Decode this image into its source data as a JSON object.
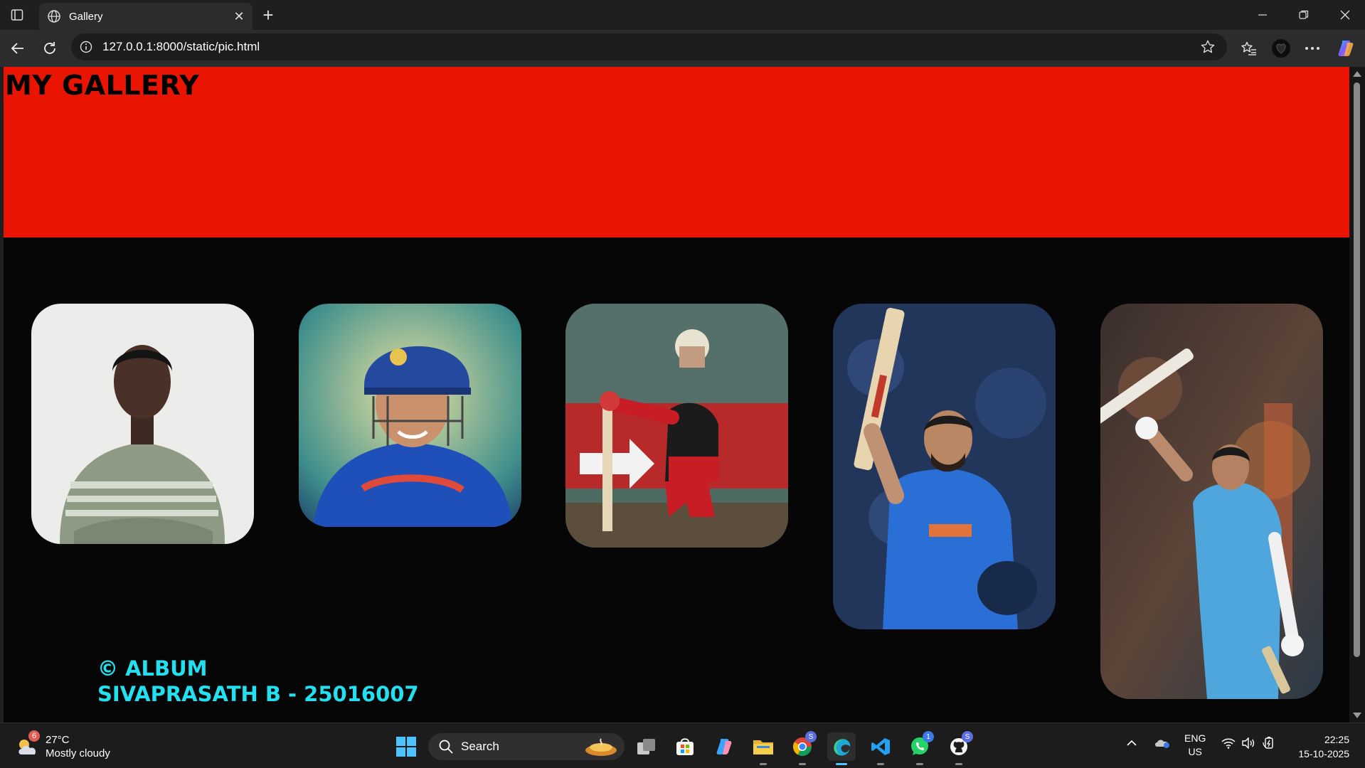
{
  "browser": {
    "tab_title": "Gallery",
    "tab_close": "✕",
    "new_tab": "+",
    "url": "127.0.0.1:8000/static/pic.html"
  },
  "page": {
    "title": "MY GALLERY",
    "photos": [
      {
        "subject": "student-portrait"
      },
      {
        "subject": "cricketer-in-helmet"
      },
      {
        "subject": "cricketer-kneeling-red-kit"
      },
      {
        "subject": "cricketer-raising-bat"
      },
      {
        "subject": "cricketer-celebrating-bat"
      }
    ],
    "footer": {
      "line1": "© ALBUM",
      "line2": "SIVAPRASATH B - 25016007"
    }
  },
  "taskbar": {
    "weather": {
      "temp": "27°C",
      "condition": "Mostly cloudy",
      "badge": "6"
    },
    "search_label": "Search",
    "whatsapp_badge": "1",
    "lang_line1": "ENG",
    "lang_line2": "US",
    "time": "22:25",
    "date": "15-10-2025"
  },
  "colors": {
    "header_bg": "#ea1402",
    "page_bg": "#060606",
    "footer_text": "#22e0f0",
    "title_text": "#000000"
  }
}
